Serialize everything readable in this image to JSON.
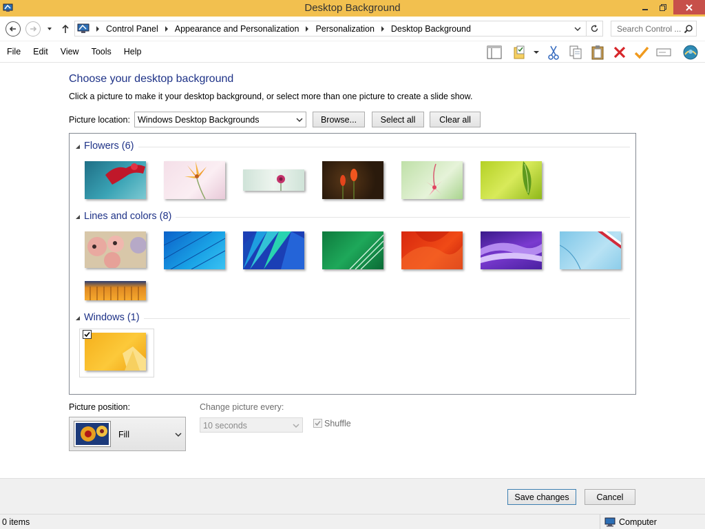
{
  "window": {
    "title": "Desktop Background",
    "minimize_icon": "minimize-icon",
    "maximize_icon": "restore-icon",
    "close_icon": "close-icon"
  },
  "address_bar": {
    "breadcrumbs": [
      "Control Panel",
      "Appearance and Personalization",
      "Personalization",
      "Desktop Background"
    ],
    "search_placeholder": "Search Control ..."
  },
  "menu": {
    "items": [
      "File",
      "Edit",
      "View",
      "Tools",
      "Help"
    ]
  },
  "toolbar": {
    "icons": [
      "layout-icon",
      "folder-properties-icon",
      "cut-icon",
      "copy-icon",
      "paste-icon",
      "delete-icon",
      "checkmark-icon",
      "rename-icon",
      "shell-icon"
    ]
  },
  "main": {
    "heading": "Choose your desktop background",
    "subtext": "Click a picture to make it your desktop background, or select more than one picture to create a slide show.",
    "picture_location": {
      "label": "Picture location:",
      "value": "Windows Desktop Backgrounds"
    },
    "buttons": {
      "browse": "Browse...",
      "select_all": "Select all",
      "clear_all": "Clear all"
    },
    "groups": [
      {
        "name": "Flowers (6)",
        "count": 6
      },
      {
        "name": "Lines and colors (8)",
        "count": 8
      },
      {
        "name": "Windows (1)",
        "count": 1,
        "selected": [
          true
        ]
      }
    ],
    "picture_position": {
      "label": "Picture position:",
      "value": "Fill"
    },
    "change_picture": {
      "label": "Change picture every:",
      "value": "10 seconds",
      "enabled": false
    },
    "shuffle": {
      "label": "Shuffle",
      "checked": true,
      "enabled": false
    }
  },
  "footer": {
    "save": "Save changes",
    "cancel": "Cancel"
  },
  "status": {
    "items": "0 items",
    "location": "Computer"
  },
  "colors": {
    "title_bar": "#f2c04f",
    "close_button": "#c7504a",
    "heading": "#1e3287"
  }
}
